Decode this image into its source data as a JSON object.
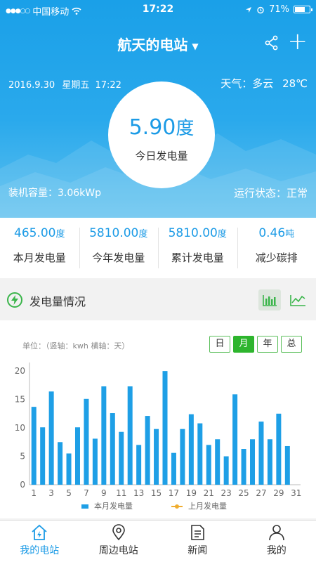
{
  "status_bar": {
    "signal": "●●●○○",
    "carrier": "中国移动",
    "time": "17:22",
    "battery": "71%",
    "battery_level": 0.71
  },
  "nav": {
    "title": "航天的电站"
  },
  "hero": {
    "date": "2016.9.30",
    "weekday": "星期五",
    "time": "17:22",
    "weather": "天气：多云",
    "temperature": "28℃",
    "today_value": "5.90",
    "today_unit": "度",
    "today_label": "今日发电量",
    "capacity": "装机容量：3.06kWp",
    "run_state": "运行状态：正常"
  },
  "stats": [
    {
      "value": "465.00",
      "unit": "度",
      "label": "本月发电量"
    },
    {
      "value": "5810.00",
      "unit": "度",
      "label": "今年发电量"
    },
    {
      "value": "5810.00",
      "unit": "度",
      "label": "累计发电量"
    },
    {
      "value": "0.46",
      "unit": "吨",
      "label": "减少碳排"
    }
  ],
  "section": {
    "title": "发电量情况"
  },
  "chart_controls": {
    "unit_note": "单位：（竖轴：kwh 横轴：天）",
    "periods": [
      "日",
      "月",
      "年",
      "总"
    ],
    "active_period": "月"
  },
  "chart_data": {
    "type": "bar",
    "categories": [
      1,
      2,
      3,
      4,
      5,
      6,
      7,
      8,
      9,
      10,
      11,
      12,
      13,
      14,
      15,
      16,
      17,
      18,
      19,
      20,
      21,
      22,
      23,
      24,
      25,
      26,
      27,
      28,
      29,
      30,
      31
    ],
    "x_tick_labels": [
      "1",
      "3",
      "5",
      "7",
      "9",
      "11",
      "13",
      "15",
      "17",
      "19",
      "21",
      "23",
      "25",
      "27",
      "29",
      "31"
    ],
    "y_ticks": [
      0,
      5,
      10,
      15,
      20
    ],
    "ylim": [
      0,
      21.5
    ],
    "series": [
      {
        "name": "本月发电量",
        "color": "#1e9fe6",
        "values": [
          13.7,
          10.1,
          16.4,
          7.5,
          5.5,
          10.1,
          15.1,
          8.1,
          17.3,
          12.6,
          9.3,
          17.3,
          7.0,
          12.1,
          9.8,
          20.0,
          5.6,
          9.8,
          12.4,
          10.8,
          7.0,
          8.0,
          5.0,
          15.9,
          6.3,
          8.0,
          11.1,
          8.0,
          12.5,
          6.8
        ]
      },
      {
        "name": "上月发电量",
        "color": "#f0ad2f",
        "values": []
      }
    ]
  },
  "tabs": [
    {
      "label": "我的电站",
      "icon": "home-bolt-icon",
      "active": true
    },
    {
      "label": "周边电站",
      "icon": "location-pin-icon",
      "active": false
    },
    {
      "label": "新闻",
      "icon": "document-icon",
      "active": false
    },
    {
      "label": "我的",
      "icon": "person-icon",
      "active": false
    }
  ]
}
